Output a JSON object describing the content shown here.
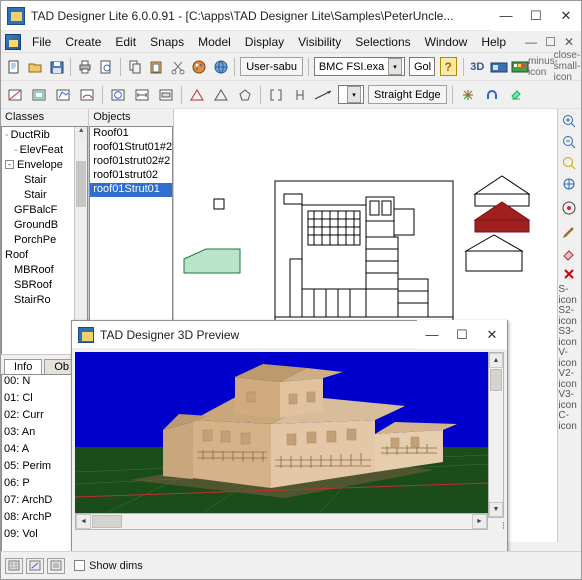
{
  "window": {
    "title": "TAD Designer Lite  6.0.0.91 - [C:\\apps\\TAD Designer Lite\\Samples\\PeterUncle...",
    "app_icon": "app-icon",
    "minimize": "—",
    "maximize": "☐",
    "close": "✕"
  },
  "menu": {
    "items": [
      "File",
      "Create",
      "Edit",
      "Snaps",
      "Model",
      "Display",
      "Visibility",
      "Selections",
      "Window",
      "Help"
    ],
    "right": [
      "—",
      "☐",
      "✕"
    ]
  },
  "toolbar1": {
    "icons": [
      "new-document-icon",
      "open-folder-icon",
      "save-disk-icon",
      "print-icon",
      "copy-icon",
      "paste-icon",
      "cut-icon",
      "palette-icon",
      "globe-icon",
      "undo-icon"
    ],
    "user_button": "User-sabu",
    "combo_value": "BMC FSI.exa",
    "combo2_value": "Gol",
    "help_label": "?",
    "icons_right": [
      "3D",
      "camera-icon",
      "grid-color-icon",
      "minus-icon",
      "close-small-icon"
    ]
  },
  "toolbar2": {
    "icons": [
      "line-icon",
      "rect-icon",
      "poly-icon",
      "arc-icon",
      "circle-icon",
      "measure-icon",
      "wall-icon",
      "door-icon",
      "window-icon",
      "warning-icon",
      "triangle-icon",
      "bracket-icon",
      "bracket2-icon",
      "arrow-icon",
      "dim-icon"
    ],
    "combo_arrow": "▾",
    "straight_edge_label": "Straight Edge",
    "right_icons": [
      "snap-icon",
      "magnet-icon",
      "paint-icon"
    ]
  },
  "classes_panel": {
    "header": "Classes",
    "items": [
      {
        "label": "DuctRib",
        "level": 1,
        "toggle": "-"
      },
      {
        "label": "ElevFeat",
        "level": 2,
        "toggle": ""
      },
      {
        "label": "Envelope",
        "level": 1,
        "toggle": "-"
      },
      {
        "label": "Stair",
        "level": 2,
        "toggle": ""
      },
      {
        "label": "Stair",
        "level": 2,
        "toggle": ""
      },
      {
        "label": "GFBalcF",
        "level": 1,
        "toggle": ""
      },
      {
        "label": "GroundB",
        "level": 1,
        "toggle": ""
      },
      {
        "label": "PorchPe",
        "level": 1,
        "toggle": ""
      },
      {
        "label": "Roof",
        "level": 0,
        "toggle": ""
      },
      {
        "label": "MBRoof",
        "level": 1,
        "toggle": ""
      },
      {
        "label": "SBRoof",
        "level": 1,
        "toggle": ""
      },
      {
        "label": "StairRo",
        "level": 1,
        "toggle": ""
      }
    ]
  },
  "objects_panel": {
    "header": "Objects",
    "items": [
      "Roof01",
      "roof01Strut01#2",
      "roof01strut02#2",
      "roof01strut02",
      "roof01Strut01"
    ],
    "selected_index": 4
  },
  "info_panel": {
    "tabs": [
      {
        "label": "Info",
        "active": true
      },
      {
        "label": "Ob",
        "active": false
      }
    ],
    "rows": [
      "00:    N",
      "01:    Cl",
      "02:  Curr",
      "03:    An",
      "04:     A",
      "05: Perim",
      "06:     P",
      "07: ArchD",
      "08: ArchP",
      "09:   Vol"
    ]
  },
  "preview": {
    "title": "TAD Designer 3D Preview",
    "minimize": "—",
    "maximize": "☐",
    "close": "✕",
    "scroll_up": "▲",
    "scroll_down": "▼",
    "scroll_left": "◄",
    "scroll_right": "►",
    "sky_color": "#0000cd",
    "ground_color": "#1a4d1a",
    "model_color": "#e0bf9a"
  },
  "statusbar": {
    "buttons": [
      "grid-toggle-icon",
      "snap-toggle-icon",
      "layer-toggle-icon"
    ],
    "checkbox_label": "Show dims"
  },
  "right_toolbar": {
    "icons": [
      "zoom-in-icon",
      "zoom-out-icon",
      "zoom-fit-icon",
      "pan-icon",
      "target-icon",
      "pencil-icon",
      "eraser-icon",
      "delete-red-icon",
      "S-icon",
      "S2-icon",
      "S3-icon",
      "V-icon",
      "V2-icon",
      "V3-icon",
      "C-icon"
    ]
  }
}
